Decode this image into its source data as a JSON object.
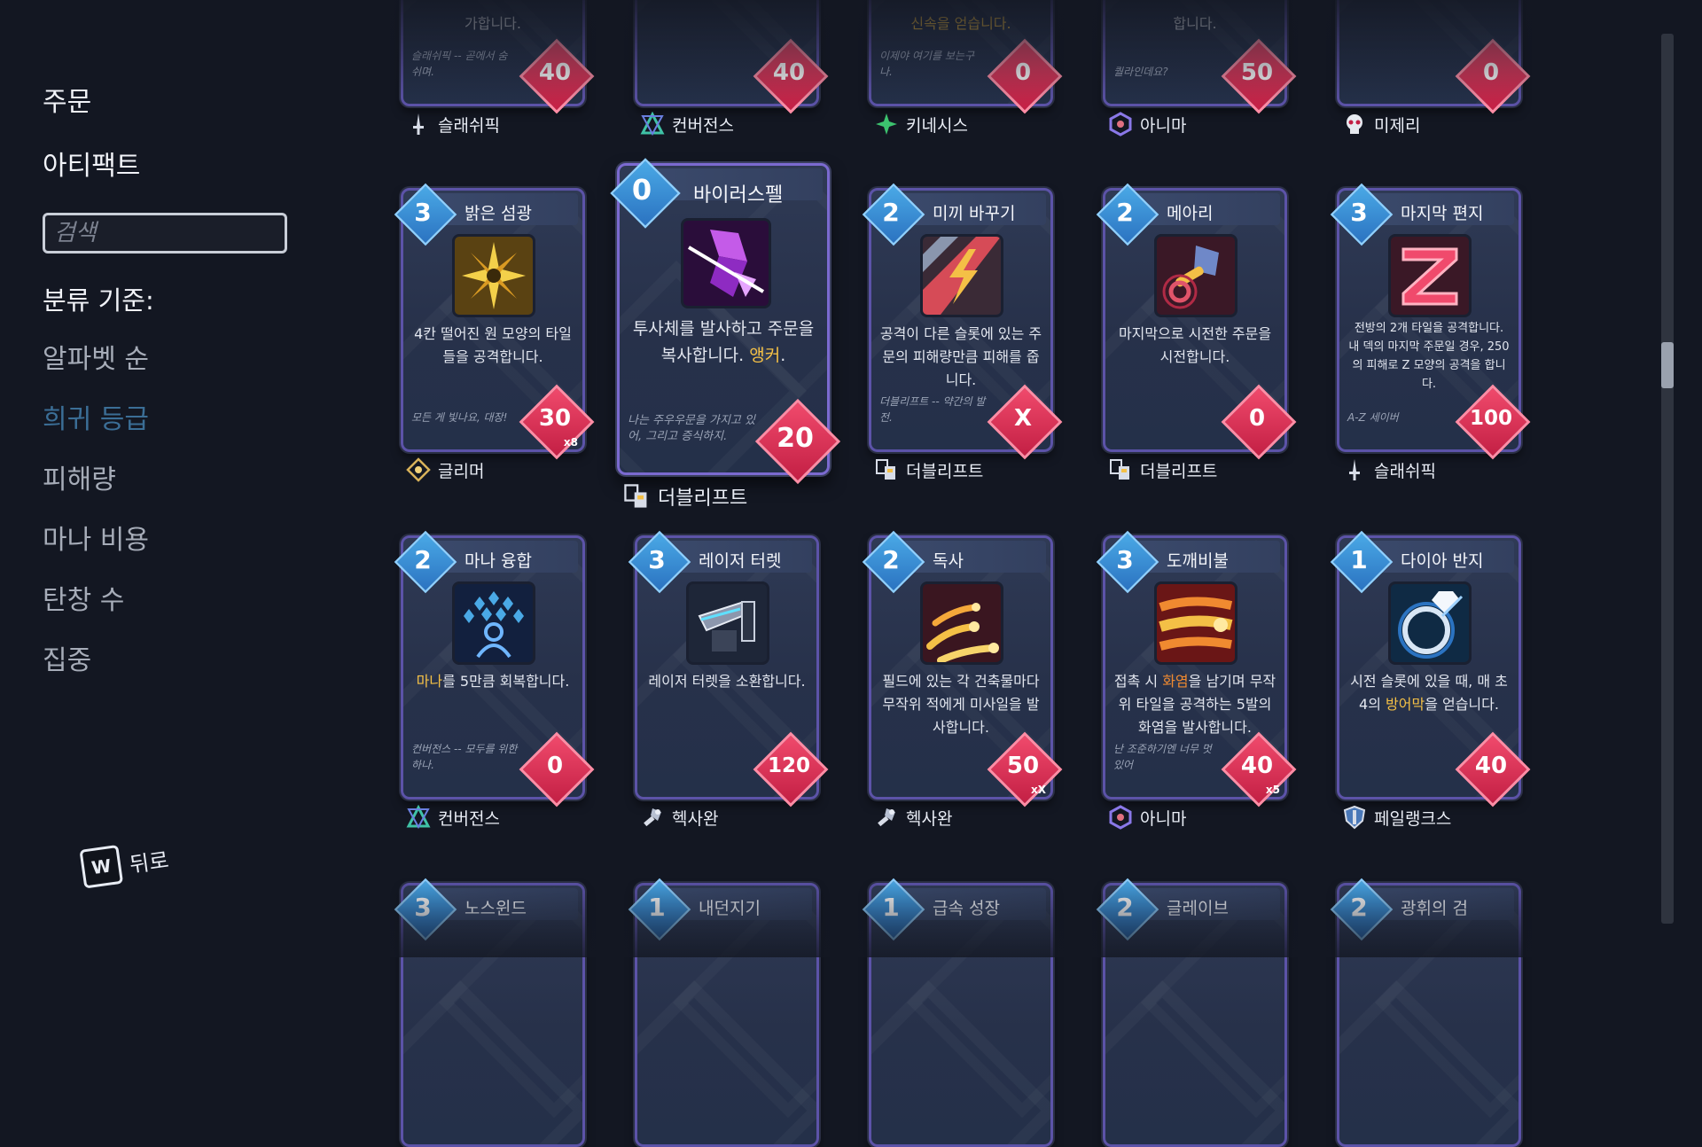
{
  "sidebar": {
    "tab_spells": "주문",
    "tab_artifacts": "아티팩트",
    "search_placeholder": "검색",
    "sort_heading": "분류 기준:",
    "sort_options": [
      "알파벳 순",
      "희귀 등급",
      "피해량",
      "마나 비용",
      "탄창 수",
      "집중"
    ],
    "active_sort": "희귀 등급",
    "back_key": "W",
    "back_label": "뒤로"
  },
  "colors": {
    "accent_active": "#3b6e96",
    "cost": "#2b73c1",
    "damage": "#c31f44",
    "highlight": "#f4c046"
  },
  "rows": [
    {
      "cards": [
        {
          "desc": "가합니다.",
          "flavor": "슬래쉬픽 -- 곧에서 숨 쉬며.",
          "damage": "40",
          "set": "슬래쉬픽",
          "set_icon": "sword-icon"
        },
        {
          "desc": "",
          "flavor": "",
          "damage": "40",
          "set": "컨버전스",
          "set_icon": "convergence-icon"
        },
        {
          "desc": "신속을 얻습니다.",
          "flavor": "이제야 여기를 보는구나.",
          "damage": "0",
          "set": "키네시스",
          "set_icon": "kinesis-icon"
        },
        {
          "desc": "합니다.",
          "flavor": "퀄라인데요?",
          "damage": "50",
          "set": "아니마",
          "set_icon": "anima-icon"
        },
        {
          "desc": "",
          "flavor": "",
          "damage": "0",
          "set": "미제리",
          "set_icon": "skull-icon"
        }
      ]
    },
    {
      "cards": [
        {
          "cost": "3",
          "title": "밝은 섬광",
          "icon": "starburst-icon",
          "desc": "4칸 떨어진 원 모양의 타일들을 공격합니다.",
          "flavor": "모든 게 빛나요, 대장!",
          "damage": "30",
          "damage_mult": "x8",
          "set": "글리머",
          "set_icon": "glimmer-icon"
        },
        {
          "cost": "0",
          "title": "바이러스펠",
          "icon": "crystal-icon",
          "desc_pre": "투사체를 발사하고 주문을 복사합니다. ",
          "desc_hl": "앵커",
          "desc_post": ".",
          "flavor": "나는 주우우문을 가지고 있어, 그리고 증식하지.",
          "damage": "20",
          "set": "더블리프트",
          "set_icon": "doublelift-icon"
        },
        {
          "cost": "2",
          "title": "미끼 바꾸기",
          "icon": "lightning-icon",
          "desc": "공격이 다른 슬롯에 있는 주문의 피해량만큼 피해를 줍니다.",
          "flavor": "더블리프트 -- 약간의 발전.",
          "damage": "X",
          "set": "더블리프트",
          "set_icon": "doublelift-icon"
        },
        {
          "cost": "2",
          "title": "메아리",
          "icon": "hammer-icon",
          "desc": "마지막으로 시전한 주문을 시전합니다.",
          "flavor": "",
          "damage": "0",
          "set": "더블리프트",
          "set_icon": "doublelift-icon"
        },
        {
          "cost": "3",
          "title": "마지막 편지",
          "icon": "z-letter-icon",
          "desc": "전방의 2개 타일을 공격합니다. 내 덱의 마지막 주문일 경우, 250의 피해로 Z 모양의 공격을 합니다.",
          "flavor": "A-Z 세이버",
          "damage": "100",
          "set": "슬래쉬픽",
          "set_icon": "sword-icon"
        }
      ]
    },
    {
      "cards": [
        {
          "cost": "2",
          "title": "마나 융합",
          "icon": "mana-gems-icon",
          "desc_hl": "마나",
          "desc_post": "를 5만큼 회복합니다.",
          "flavor": "컨버전스 -- 모두를 위한 하나.",
          "damage": "0",
          "set": "컨버전스",
          "set_icon": "convergence-icon"
        },
        {
          "cost": "3",
          "title": "레이저 터렛",
          "icon": "turret-icon",
          "desc": "레이저 터렛을 소환합니다.",
          "flavor": "",
          "damage": "120",
          "set": "헥사완",
          "set_icon": "hexawan-icon"
        },
        {
          "cost": "2",
          "title": "독사",
          "icon": "fire-streaks-icon",
          "desc": "필드에 있는 각 건축물마다 무작위 적에게 미사일을 발사합니다.",
          "flavor": "",
          "damage": "50",
          "damage_mult": "xX",
          "set": "헥사완",
          "set_icon": "hexawan-icon"
        },
        {
          "cost": "3",
          "title": "도깨비불",
          "icon": "fireball-icon",
          "desc_pre": "접촉 시 ",
          "desc_hl": "화염",
          "desc_post": "을 남기며 무작위 타일을 공격하는 5발의 화염을 발사합니다.",
          "flavor": "난 조준하기엔 너무 멋있어",
          "damage": "40",
          "damage_mult": "x5",
          "set": "아니마",
          "set_icon": "anima-icon"
        },
        {
          "cost": "1",
          "title": "다이아 반지",
          "icon": "ring-icon",
          "desc_pre": "시전 슬롯에 있을 때, 매 초 4의 ",
          "desc_hl": "방어막",
          "desc_post": "을 얻습니다.",
          "flavor": "",
          "damage": "40",
          "set": "페일랭크스",
          "set_icon": "shield-icon"
        }
      ]
    },
    {
      "cards": [
        {
          "cost": "3",
          "title": "노스윈드"
        },
        {
          "cost": "1",
          "title": "내던지기"
        },
        {
          "cost": "1",
          "title": "급속 성장"
        },
        {
          "cost": "2",
          "title": "글레이브"
        },
        {
          "cost": "2",
          "title": "광휘의 검"
        }
      ]
    }
  ]
}
